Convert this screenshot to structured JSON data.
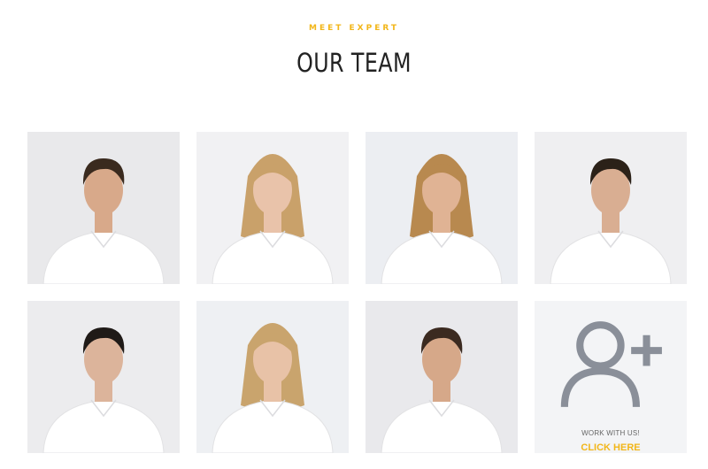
{
  "section": {
    "eyebrow": "MEET EXPERT",
    "title": "OUR TEAM"
  },
  "team": {
    "members": [
      {
        "photo_icon": "bearded-man-photo",
        "hair": "#3a2a1e",
        "skin": "#d8a98a",
        "bg": "#e9e9eb"
      },
      {
        "photo_icon": "blonde-woman-photo",
        "hair": "#c9a16a",
        "skin": "#e9c3aa",
        "bg": "#f1f1f3"
      },
      {
        "photo_icon": "wavy-hair-woman-photo",
        "hair": "#b8894f",
        "skin": "#e0b394",
        "bg": "#eceef2"
      },
      {
        "photo_icon": "tattooed-man-photo",
        "hair": "#2b2118",
        "skin": "#d9ae92",
        "bg": "#efeff1"
      },
      {
        "photo_icon": "pierced-man-photo",
        "hair": "#1f1a17",
        "skin": "#dcb49b",
        "bg": "#ececee"
      },
      {
        "photo_icon": "curly-blonde-woman-photo",
        "hair": "#c9a46d",
        "skin": "#e8c2a7",
        "bg": "#eef0f3"
      },
      {
        "photo_icon": "man-white-shirt-photo",
        "hair": "#3b2a20",
        "skin": "#d6a889",
        "bg": "#e9e9ec"
      }
    ]
  },
  "cta": {
    "icon": "add-user-icon",
    "label": "WORK WITH US!",
    "link": "CLICK HERE",
    "accent": "#f2b619"
  }
}
